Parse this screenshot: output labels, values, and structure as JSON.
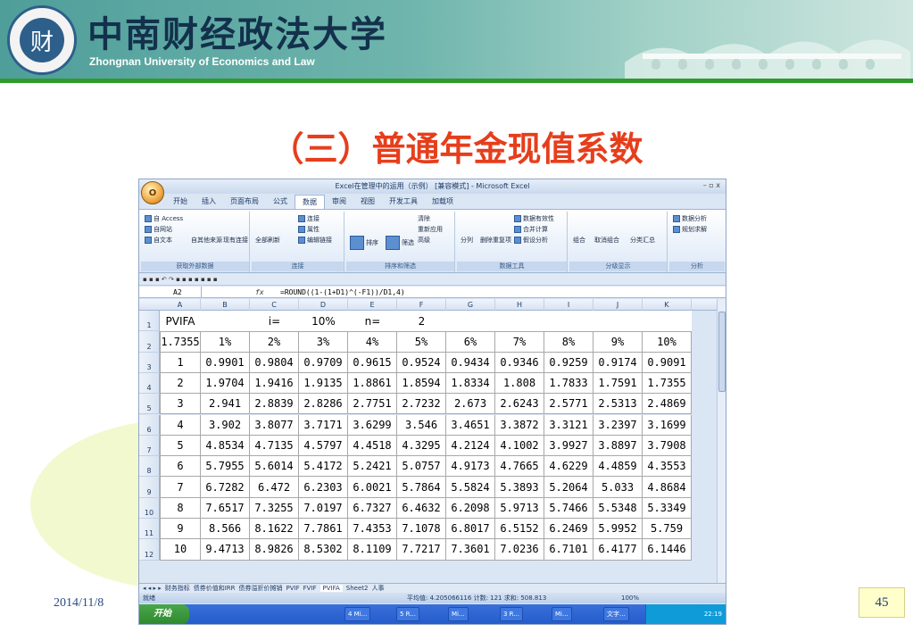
{
  "header": {
    "university_cn": "中南财经政法大学",
    "university_en": "Zhongnan University of Economics and Law",
    "logo_text": "财"
  },
  "slide": {
    "title": "（三）普通年金现值系数",
    "date": "2014/11/8",
    "page_number": "45"
  },
  "excel": {
    "window_title": "Excel在管理中的运用（示例） [兼容模式] - Microsoft Excel",
    "window_buttons": "–  ▫  x",
    "orb_label": "Office",
    "menu_tabs": [
      "开始",
      "插入",
      "页面布局",
      "公式",
      "数据",
      "审阅",
      "视图",
      "开发工具",
      "加载项"
    ],
    "active_tab": "数据",
    "ribbon": {
      "group_external": {
        "label": "获取外部数据",
        "items": [
          "自 Access",
          "自网站",
          "自文本",
          "自其他来源",
          "现有连接"
        ]
      },
      "group_connections": {
        "label": "连接",
        "items": [
          "全部刷新",
          "连接",
          "属性",
          "编辑链接"
        ]
      },
      "group_sort": {
        "label": "排序和筛选",
        "items": [
          "排序",
          "筛选",
          "清除",
          "重新应用",
          "高级"
        ]
      },
      "group_tools": {
        "label": "数据工具",
        "items": [
          "分列",
          "删除重复项",
          "数据有效性",
          "合并计算",
          "假设分析"
        ]
      },
      "group_outline": {
        "label": "分级显示",
        "items": [
          "组合",
          "取消组合",
          "分类汇总"
        ]
      },
      "group_analysis": {
        "label": "分析",
        "items": [
          "数据分析",
          "规划求解"
        ]
      }
    },
    "name_box": "A2",
    "fx_label": "fx",
    "formula": "=ROUND((1-(1+D1)^(-F1))/D1,4)",
    "columns": [
      "A",
      "B",
      "C",
      "D",
      "E",
      "F",
      "G",
      "H",
      "I",
      "J",
      "K"
    ],
    "row_numbers": [
      "1",
      "2",
      "3",
      "4",
      "5",
      "6",
      "7",
      "8",
      "9",
      "10",
      "11",
      "12"
    ],
    "row1": [
      "PVIFA",
      "",
      "i=",
      "10%",
      "n=",
      "2",
      "",
      "",
      "",
      "",
      ""
    ],
    "row2": [
      "1.7355",
      "1%",
      "2%",
      "3%",
      "4%",
      "5%",
      "6%",
      "7%",
      "8%",
      "9%",
      "10%"
    ],
    "table_rows": [
      [
        "1",
        "0.9901",
        "0.9804",
        "0.9709",
        "0.9615",
        "0.9524",
        "0.9434",
        "0.9346",
        "0.9259",
        "0.9174",
        "0.9091"
      ],
      [
        "2",
        "1.9704",
        "1.9416",
        "1.9135",
        "1.8861",
        "1.8594",
        "1.8334",
        "1.808",
        "1.7833",
        "1.7591",
        "1.7355"
      ],
      [
        "3",
        "2.941",
        "2.8839",
        "2.8286",
        "2.7751",
        "2.7232",
        "2.673",
        "2.6243",
        "2.5771",
        "2.5313",
        "2.4869"
      ],
      [
        "4",
        "3.902",
        "3.8077",
        "3.7171",
        "3.6299",
        "3.546",
        "3.4651",
        "3.3872",
        "3.3121",
        "3.2397",
        "3.1699"
      ],
      [
        "5",
        "4.8534",
        "4.7135",
        "4.5797",
        "4.4518",
        "4.3295",
        "4.2124",
        "4.1002",
        "3.9927",
        "3.8897",
        "3.7908"
      ],
      [
        "6",
        "5.7955",
        "5.6014",
        "5.4172",
        "5.2421",
        "5.0757",
        "4.9173",
        "4.7665",
        "4.6229",
        "4.4859",
        "4.3553"
      ],
      [
        "7",
        "6.7282",
        "6.472",
        "6.2303",
        "6.0021",
        "5.7864",
        "5.5824",
        "5.3893",
        "5.2064",
        "5.033",
        "4.8684"
      ],
      [
        "8",
        "7.6517",
        "7.3255",
        "7.0197",
        "6.7327",
        "6.4632",
        "6.2098",
        "5.9713",
        "5.7466",
        "5.5348",
        "5.3349"
      ],
      [
        "9",
        "8.566",
        "8.1622",
        "7.7861",
        "7.4353",
        "7.1078",
        "6.8017",
        "6.5152",
        "6.2469",
        "5.9952",
        "5.759"
      ],
      [
        "10",
        "9.4713",
        "8.9826",
        "8.5302",
        "8.1109",
        "7.7217",
        "7.3601",
        "7.0236",
        "6.7101",
        "6.4177",
        "6.1446"
      ]
    ],
    "sheet_tabs": [
      "财务指标",
      "债券价值和IRR",
      "债券溢折价摊销",
      "PVIF",
      "FVIF",
      "PVIFA",
      "Sheet2",
      "人事"
    ],
    "active_sheet": "PVIFA",
    "status_ready": "就绪",
    "status_stats": "平均值: 4.205066116   计数: 121   求和: 508.813",
    "status_zoom": "100%",
    "taskbar": {
      "start_label": "开始",
      "items": [
        "4 Mi...",
        "5 R...",
        "Mi...",
        "3 R...",
        "Mi...",
        "文字..."
      ],
      "clock": "22:19"
    }
  }
}
